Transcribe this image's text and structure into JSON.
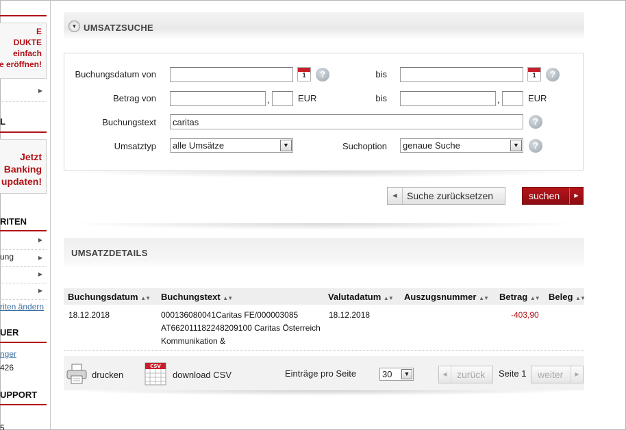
{
  "sidebar": {
    "promo1": [
      "E",
      "DUKTE",
      "einfach",
      "e eröffnen!"
    ],
    "promo2": [
      "Jetzt",
      "Banking",
      "updaten!"
    ],
    "head_l": "L",
    "head_riten": "RITEN",
    "links": [
      "",
      "ung",
      "",
      ""
    ],
    "riten_link": "riten ändern",
    "head_uer": "UER",
    "nger_link": "nger",
    "num": "426",
    "head_support": "UPPORT",
    "bottom": "5"
  },
  "search": {
    "title": "UMSATZSUCHE",
    "label_date_from": "Buchungsdatum von",
    "label_bis": "bis",
    "label_amount_from": "Betrag von",
    "label_text": "Buchungstext",
    "label_type": "Umsatztyp",
    "label_option": "Suchoption",
    "date_from": "",
    "date_to": "",
    "amount_from": "",
    "amount_from_cents": "",
    "amount_to": "",
    "amount_to_cents": "",
    "comma": ",",
    "currency": "EUR",
    "text_value": "caritas",
    "type_value": "alle Umsätze",
    "option_value": "genaue Suche",
    "cal_day": "1",
    "help": "?",
    "reset_label": "Suche zurücksetzen",
    "search_label": "suchen"
  },
  "details": {
    "title": "UMSATZDETAILS",
    "columns": [
      "Buchungsdatum",
      "Buchungstext",
      "Valutadatum",
      "Auszugsnummer",
      "Betrag",
      "Beleg"
    ],
    "rows": [
      {
        "date": "18.12.2018",
        "text": [
          "000136080041Caritas FE/000003085",
          "AT662011182248209100 Caritas Österreich",
          "Kommunikation &"
        ],
        "valuta": "18.12.2018",
        "auszug": "",
        "amount": "-403,90",
        "beleg": ""
      }
    ],
    "print_label": "drucken",
    "csv_label": "download CSV",
    "csv_badge": "CSV",
    "per_page_label": "Einträge pro Seite",
    "per_page_value": "30",
    "prev_label": "zurück",
    "page_label": "Seite 1",
    "next_label": "weiter"
  }
}
